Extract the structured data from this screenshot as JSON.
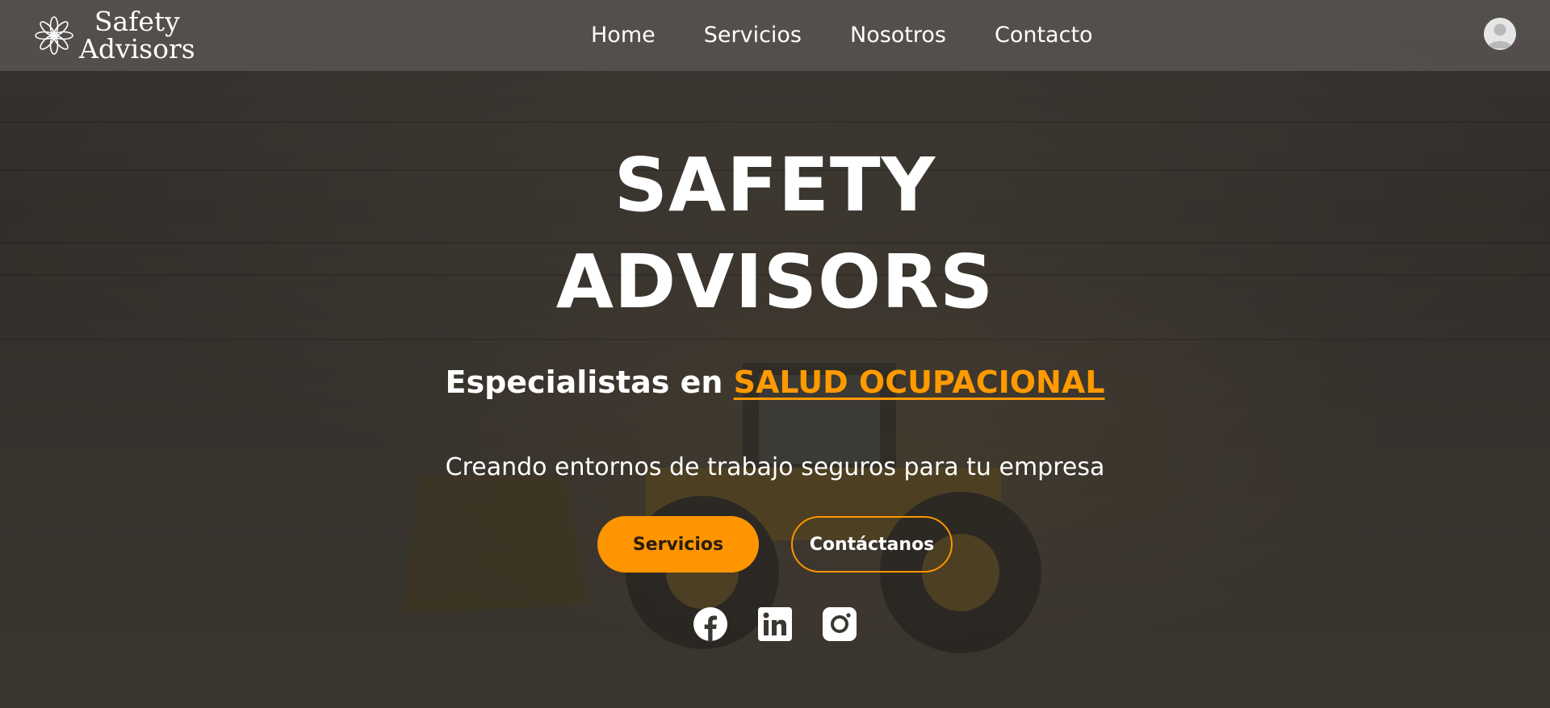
{
  "brand": {
    "line1": "Safety",
    "line2": "Advisors"
  },
  "nav": {
    "items": [
      "Home",
      "Servicios",
      "Nosotros",
      "Contacto"
    ]
  },
  "hero": {
    "title_line1": "SAFETY",
    "title_line2": "ADVISORS",
    "tagline_prefix": "Especialistas en",
    "tagline_accent": "SALUD OCUPACIONAL",
    "subtitle": "Creando entornos de trabajo seguros para tu empresa",
    "primary_button": "Servicios",
    "secondary_button": "Contáctanos"
  },
  "social": {
    "icons": [
      "facebook-icon",
      "linkedin-icon",
      "instagram-icon"
    ]
  },
  "colors": {
    "accent": "#ff9500",
    "header_bg": "#5a5552",
    "text": "#ffffff"
  }
}
